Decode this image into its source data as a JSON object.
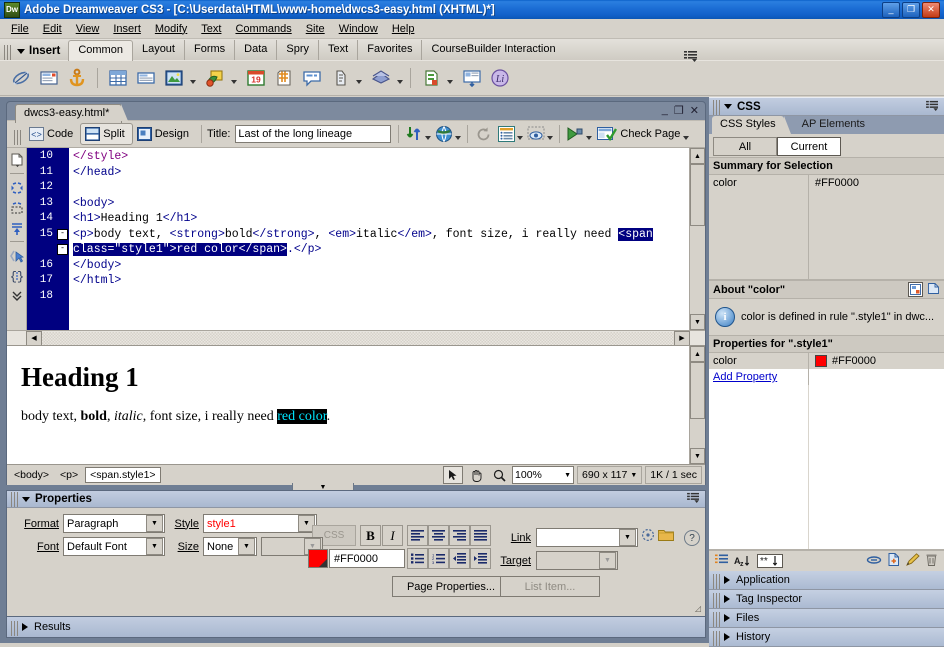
{
  "window": {
    "title": "Adobe Dreamweaver CS3 - [C:\\Userdata\\HTML\\www-home\\dwcs3-easy.html (XHTML)*]",
    "app_icon": "Dw",
    "minimize": "_",
    "maximize": "❐",
    "close": "✕"
  },
  "menubar": [
    "File",
    "Edit",
    "View",
    "Insert",
    "Modify",
    "Text",
    "Commands",
    "Site",
    "Window",
    "Help"
  ],
  "insert_bar": {
    "label": "Insert",
    "tabs": [
      "Common",
      "Layout",
      "Forms",
      "Data",
      "Spry",
      "Text",
      "Favorites",
      "CourseBuilder Interaction"
    ],
    "active_tab": "Common",
    "icons": [
      "hyperlink-icon",
      "email-link-icon",
      "named-anchor-icon",
      "table-icon",
      "insert-div-tag-icon",
      "image-icon",
      "media-icon",
      "date-icon",
      "server-side-include-icon",
      "comment-icon",
      "script-icon",
      "templates-icon",
      "tag-chooser-icon",
      "head-icon",
      "coursebuilder-icon"
    ]
  },
  "document": {
    "tab_label": "dwcs3-easy.html*",
    "win_minimize": "_",
    "win_restore": "❐",
    "win_close": "✕",
    "view_buttons": [
      {
        "label": "Code",
        "icon": "code-view-icon",
        "active": false
      },
      {
        "label": "Split",
        "icon": "split-view-icon",
        "active": true
      },
      {
        "label": "Design",
        "icon": "design-view-icon",
        "active": false
      }
    ],
    "title_label": "Title:",
    "title_value": "Last of the long lineage",
    "toolbar_icons": [
      "file-management-icon",
      "preview-in-browser-icon",
      "refresh-icon",
      "view-options-icon",
      "visual-aids-icon",
      "validate-markup-icon"
    ],
    "check_page_label": "Check Page"
  },
  "code_view": {
    "gutter_numbers": [
      "10",
      "11",
      "12",
      "13",
      "14",
      "15",
      "16",
      "17",
      "18"
    ],
    "lines": [
      {
        "n": "10",
        "text": "</style>",
        "kind": "tag-close-style"
      },
      {
        "n": "11",
        "text": "</head>",
        "kind": "tag"
      },
      {
        "n": "12",
        "text": "",
        "kind": "blank"
      },
      {
        "n": "13",
        "text": "<body>",
        "kind": "tag"
      },
      {
        "n": "14",
        "text": "<h1>Heading 1</h1>",
        "kind": "tag"
      },
      {
        "n": "15",
        "text": "<p>body text, <strong>bold</strong>, <em>italic</em>, font size, i really need <span",
        "kind": "tag"
      },
      {
        "n": "",
        "text": "class=\"style1\">red color</span>.</p>",
        "kind": "wrapped"
      },
      {
        "n": "16",
        "text": "</body>",
        "kind": "tag"
      },
      {
        "n": "17",
        "text": "</html>",
        "kind": "tag"
      },
      {
        "n": "18",
        "text": "",
        "kind": "blank"
      }
    ],
    "selection_text": "<span class=\"style1\">red color</span>",
    "fold_marker": "-",
    "side_tool_icons": [
      "open-documents-icon",
      "collapse-full-tag-icon",
      "collapse-selection-icon",
      "expand-all-icon",
      "select-parent-tag-icon",
      "balance-braces-icon",
      "more-icon"
    ]
  },
  "design_view": {
    "heading": "Heading 1",
    "paragraph_parts": [
      {
        "text": "body text, ",
        "style": "normal"
      },
      {
        "text": "bold",
        "style": "bold"
      },
      {
        "text": ", ",
        "style": "normal"
      },
      {
        "text": "italic",
        "style": "italic"
      },
      {
        "text": ", font size, i really need ",
        "style": "normal"
      },
      {
        "text": "red color",
        "style": "selected"
      },
      {
        "text": ".",
        "style": "normal"
      }
    ]
  },
  "status_bar": {
    "tag_selector": [
      "<body>",
      "<p>",
      "<span.style1>"
    ],
    "active_tag": "<span.style1>",
    "tools": [
      "select-tool-icon",
      "hand-tool-icon",
      "zoom-tool-icon"
    ],
    "zoom": "100%",
    "window_size": "690 x 117",
    "doc_size": "1K / 1 sec"
  },
  "properties": {
    "title": "Properties",
    "format_label": "Format",
    "format_value": "Paragraph",
    "font_label": "Font",
    "font_value": "Default Font",
    "style_label": "Style",
    "style_value": "style1",
    "style_value_color": "#FF0000",
    "size_label": "Size",
    "size_value": "None",
    "size_unit_value": "",
    "css_button": "CSS",
    "bold_button": "B",
    "italic_button": "I",
    "align_icons": [
      "align-left-icon",
      "align-center-icon",
      "align-right-icon",
      "align-justify-icon"
    ],
    "list_icons": [
      "unordered-list-icon",
      "ordered-list-icon",
      "outdent-icon",
      "indent-icon"
    ],
    "color_swatch": "#FF0000",
    "color_hex": "#FF0000",
    "link_label": "Link",
    "link_value": "",
    "target_label": "Target",
    "target_value": "",
    "point_to_file_icon": "point-to-file-icon",
    "browse_folder_icon": "browse-folder-icon",
    "page_properties_button": "Page Properties...",
    "list_item_button": "List Item...",
    "help_icon": "?"
  },
  "results_panel": {
    "label": "Results"
  },
  "css_panel": {
    "title": "CSS",
    "tabs": [
      {
        "label": "CSS Styles",
        "active": true
      },
      {
        "label": "AP Elements",
        "active": false
      }
    ],
    "mode_buttons": [
      {
        "label": "All",
        "active": false
      },
      {
        "label": "Current",
        "active": true
      }
    ],
    "summary_header": "Summary for Selection",
    "summary_rows": [
      {
        "property": "color",
        "value": "#FF0000"
      }
    ],
    "about_header": "About \"color\"",
    "about_text": "color is defined in rule \".style1\" in dwc...",
    "about_icons": [
      "show-category-view-icon",
      "show-list-view-icon"
    ],
    "properties_header": "Properties for \".style1\"",
    "property_rows": [
      {
        "property": "color",
        "swatch": "#FF0000",
        "value": "#FF0000"
      }
    ],
    "add_property_link": "Add Property",
    "toolbar_icons": [
      "show-category-view-icon",
      "show-list-view-icon",
      "show-only-set-properties-icon",
      "attach-style-sheet-icon",
      "new-css-rule-icon",
      "edit-style-icon",
      "delete-css-rule-icon"
    ]
  },
  "collapsed_panels": [
    {
      "label": "Application"
    },
    {
      "label": "Tag Inspector"
    },
    {
      "label": "Files"
    },
    {
      "label": "History"
    }
  ]
}
